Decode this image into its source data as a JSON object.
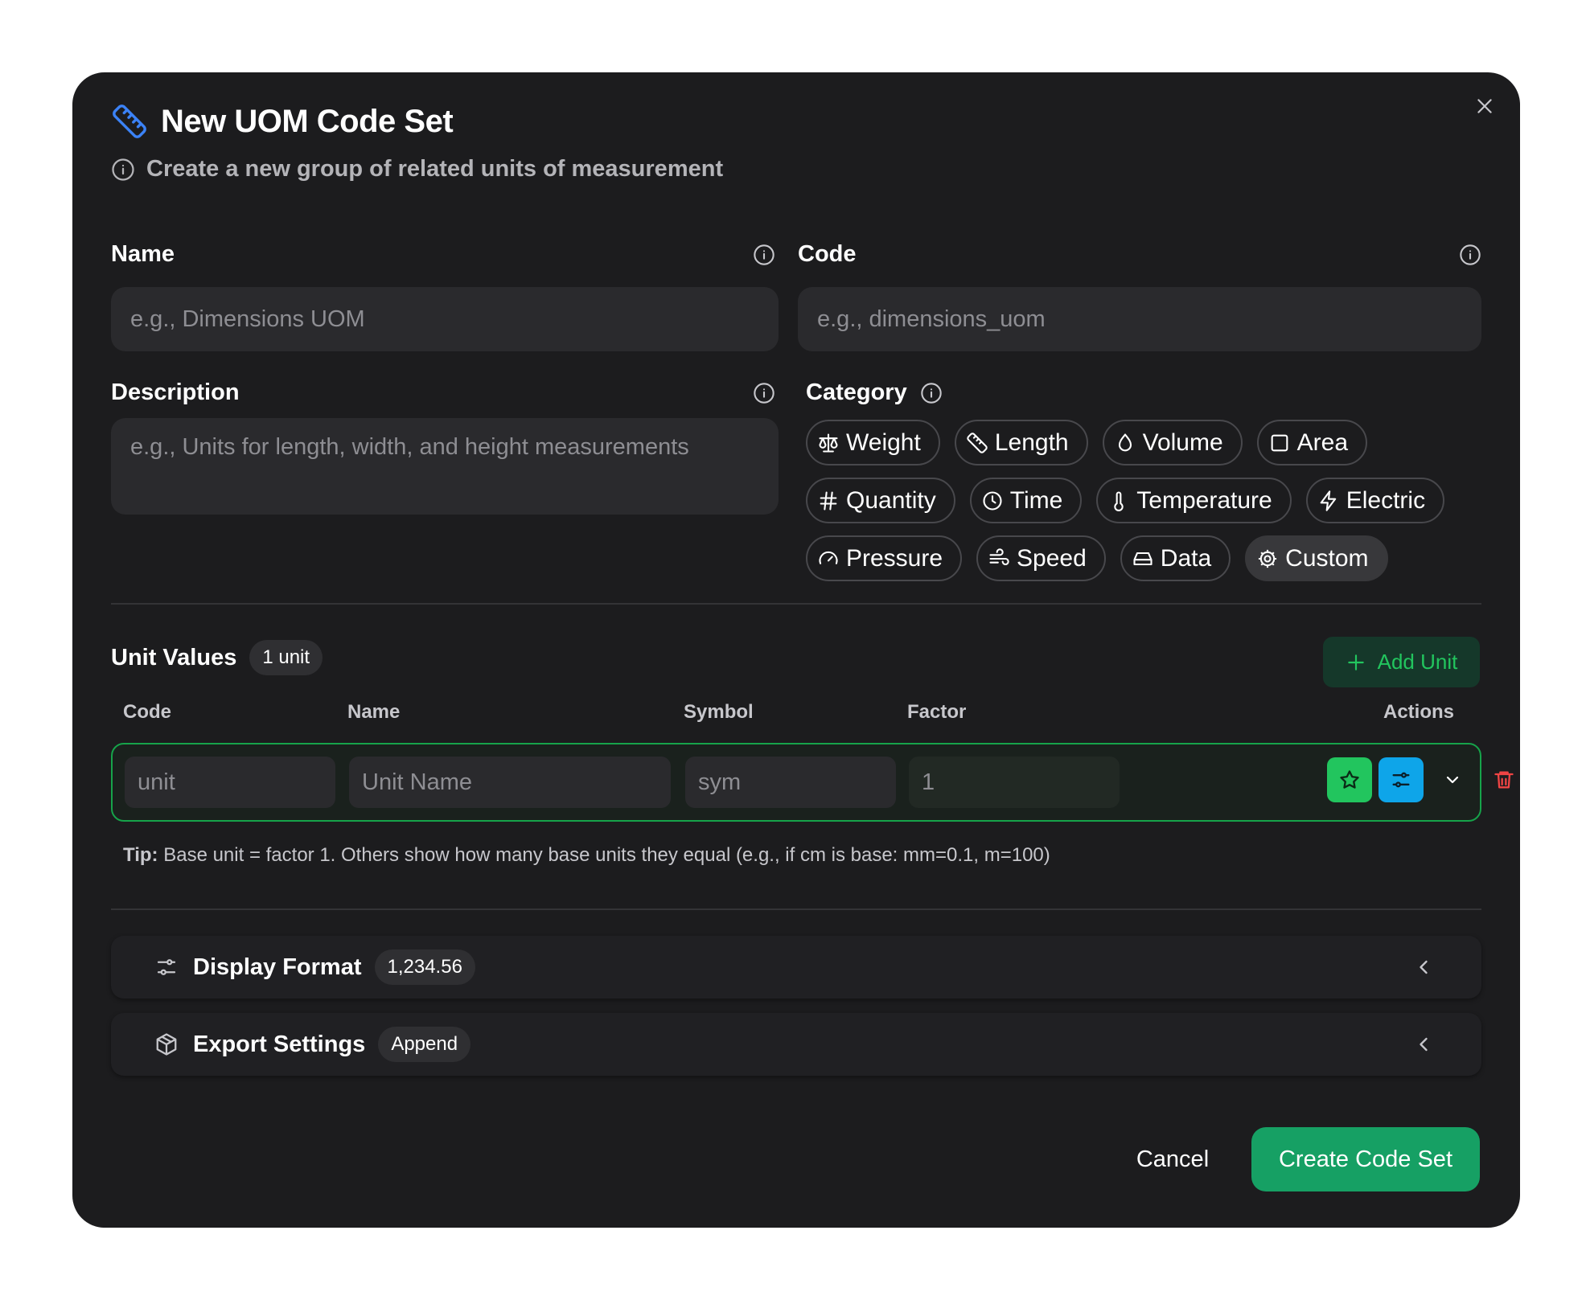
{
  "dialog": {
    "title": "New UOM Code Set",
    "subtitle": "Create a new group of related units of measurement"
  },
  "form": {
    "name": {
      "label": "Name",
      "placeholder": "e.g., Dimensions UOM"
    },
    "code": {
      "label": "Code",
      "placeholder": "e.g., dimensions_uom"
    },
    "description": {
      "label": "Description",
      "placeholder": "e.g., Units for length, width, and height measurements"
    },
    "category": {
      "label": "Category",
      "selected": "Custom",
      "options": [
        {
          "label": "Weight",
          "icon": "scale-icon"
        },
        {
          "label": "Length",
          "icon": "ruler-icon"
        },
        {
          "label": "Volume",
          "icon": "droplet-icon"
        },
        {
          "label": "Area",
          "icon": "square-icon"
        },
        {
          "label": "Quantity",
          "icon": "hash-icon"
        },
        {
          "label": "Time",
          "icon": "clock-icon"
        },
        {
          "label": "Temperature",
          "icon": "thermometer-icon"
        },
        {
          "label": "Electric",
          "icon": "bolt-icon"
        },
        {
          "label": "Pressure",
          "icon": "gauge-icon"
        },
        {
          "label": "Speed",
          "icon": "wind-icon"
        },
        {
          "label": "Data",
          "icon": "hard-drive-icon"
        },
        {
          "label": "Custom",
          "icon": "cog-icon"
        }
      ]
    }
  },
  "units": {
    "title": "Unit Values",
    "count_badge": "1 unit",
    "add_label": "Add Unit",
    "columns": [
      "Code",
      "Name",
      "Symbol",
      "Factor",
      "Actions"
    ],
    "rows": [
      {
        "code_placeholder": "unit",
        "name_placeholder": "Unit Name",
        "symbol_placeholder": "sym",
        "factor": "1"
      }
    ],
    "tip_bold": "Tip:",
    "tip_text": " Base unit = factor 1. Others show how many base units they equal (e.g., if cm is base: mm=0.1, m=100)"
  },
  "accordions": [
    {
      "title": "Display Format",
      "badge": "1,234.56",
      "icon": "sliders-icon"
    },
    {
      "title": "Export Settings",
      "badge": "Append",
      "icon": "package-icon"
    }
  ],
  "footer": {
    "cancel_label": "Cancel",
    "submit_label": "Create Code Set"
  },
  "colors": {
    "accent": "#16a064",
    "ruler_icon": "#3b82f6",
    "star_button": "#22c55e",
    "sliders_button": "#0ea5e9",
    "delete": "#ef4444"
  }
}
